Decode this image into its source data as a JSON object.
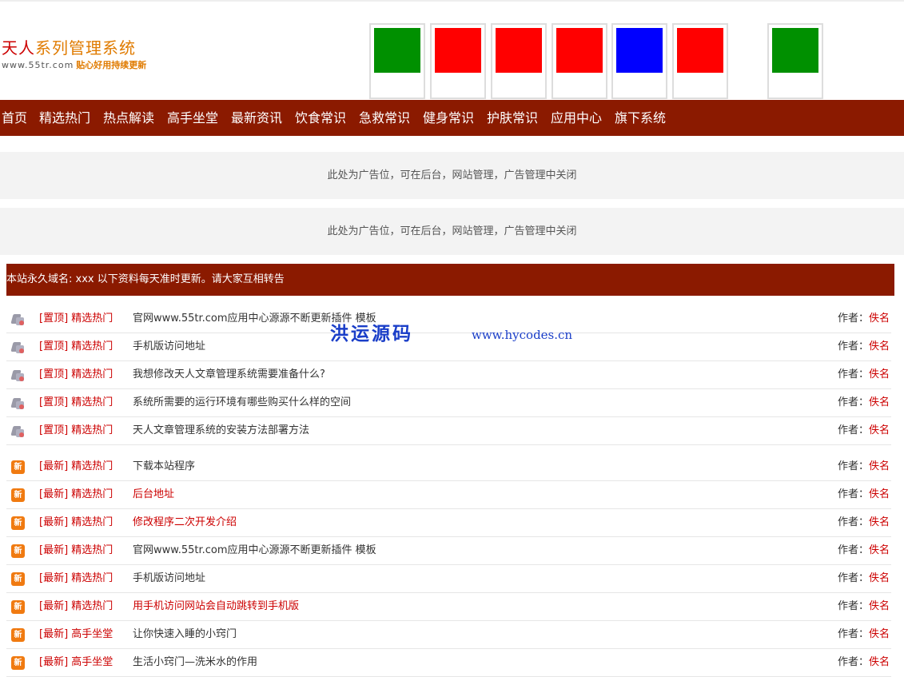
{
  "logo": {
    "title_part1": "天人",
    "title_part2": "系列管理系统",
    "url": "www.55tr.com",
    "slogan": "贴心好用持续更新"
  },
  "thumbnails": [
    {
      "color": "#009000"
    },
    {
      "color": "#ff0000"
    },
    {
      "color": "#ff0000"
    },
    {
      "color": "#ff0000"
    },
    {
      "color": "#0000ff"
    },
    {
      "color": "#ff0000"
    },
    {
      "color": "#009000"
    }
  ],
  "nav": [
    "首页",
    "精选热门",
    "热点解读",
    "高手坐堂",
    "最新资讯",
    "饮食常识",
    "急救常识",
    "健身常识",
    "护肤常识",
    "应用中心",
    "旗下系统"
  ],
  "ads": [
    "此处为广告位，可在后台，网站管理，广告管理中关闭",
    "此处为广告位，可在后台，网站管理，广告管理中关闭"
  ],
  "notice": "本站永久域名: xxx 以下资料每天准时更新。请大家互相转告",
  "author_label": "作者：",
  "top_items": [
    {
      "tag": "[置顶] 精选热门",
      "title": "官网www.55tr.com应用中心源源不断更新插件 模板",
      "author": "佚名",
      "highlight": false
    },
    {
      "tag": "[置顶] 精选热门",
      "title": "手机版访问地址",
      "author": "佚名",
      "highlight": false
    },
    {
      "tag": "[置顶] 精选热门",
      "title": "我想修改天人文章管理系统需要准备什么?",
      "author": "佚名",
      "highlight": false
    },
    {
      "tag": "[置顶] 精选热门",
      "title": "系统所需要的运行环境有哪些购买什么样的空间",
      "author": "佚名",
      "highlight": false
    },
    {
      "tag": "[置顶] 精选热门",
      "title": "天人文章管理系统的安装方法部署方法",
      "author": "佚名",
      "highlight": false
    }
  ],
  "new_icon_text": "新",
  "new_items": [
    {
      "tag": "[最新] 精选热门",
      "title": "下载本站程序",
      "author": "佚名",
      "highlight": false
    },
    {
      "tag": "[最新] 精选热门",
      "title": "后台地址",
      "author": "佚名",
      "highlight": true
    },
    {
      "tag": "[最新] 精选热门",
      "title": "修改程序二次开发介绍",
      "author": "佚名",
      "highlight": true
    },
    {
      "tag": "[最新] 精选热门",
      "title": "官网www.55tr.com应用中心源源不断更新插件 模板",
      "author": "佚名",
      "highlight": false
    },
    {
      "tag": "[最新] 精选热门",
      "title": "手机版访问地址",
      "author": "佚名",
      "highlight": false
    },
    {
      "tag": "[最新] 精选热门",
      "title": "用手机访问网站会自动跳转到手机版",
      "author": "佚名",
      "highlight": true
    },
    {
      "tag": "[最新] 高手坐堂",
      "title": "让你快速入睡的小窍门",
      "author": "佚名",
      "highlight": false
    },
    {
      "tag": "[最新] 高手坐堂",
      "title": "生活小窍门—洗米水的作用",
      "author": "佚名",
      "highlight": false
    }
  ],
  "watermark": {
    "cn": "洪运源码",
    "en": "www.hycodes.cn"
  }
}
